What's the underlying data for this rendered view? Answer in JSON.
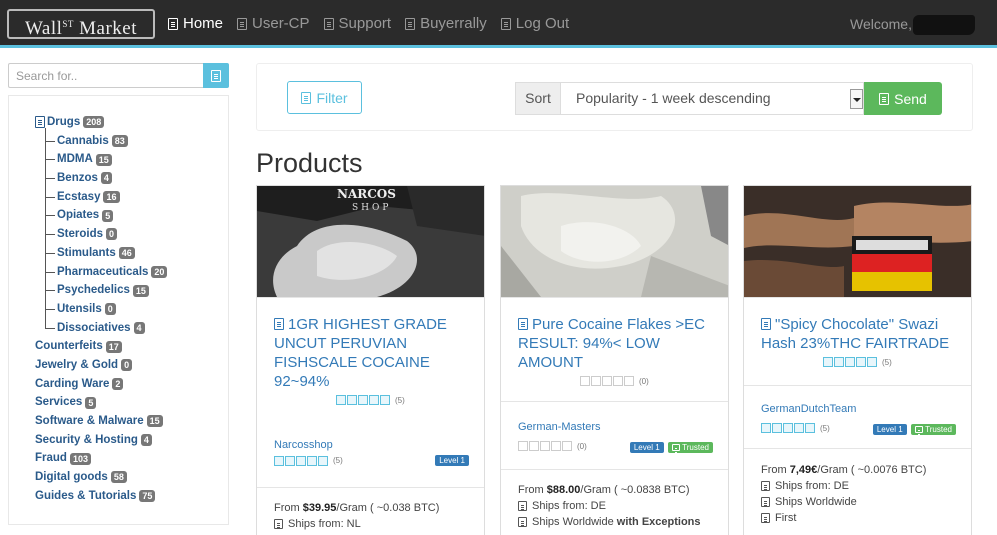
{
  "brand": {
    "name": "Wall",
    "sup": "ST",
    "name2": "Market"
  },
  "nav": [
    {
      "label": "Home",
      "active": true
    },
    {
      "label": "User-CP"
    },
    {
      "label": "Support"
    },
    {
      "label": "Buyerrally"
    },
    {
      "label": "Log Out"
    }
  ],
  "welcome": "Welcome,",
  "search": {
    "placeholder": "Search for.."
  },
  "categories": {
    "drugs": {
      "label": "Drugs",
      "count": "208"
    },
    "drug_subs": [
      {
        "label": "Cannabis",
        "count": "83"
      },
      {
        "label": "MDMA",
        "count": "15"
      },
      {
        "label": "Benzos",
        "count": "4"
      },
      {
        "label": "Ecstasy",
        "count": "16"
      },
      {
        "label": "Opiates",
        "count": "5"
      },
      {
        "label": "Steroids",
        "count": "0"
      },
      {
        "label": "Stimulants",
        "count": "46"
      },
      {
        "label": "Pharmaceuticals",
        "count": "20"
      },
      {
        "label": "Psychedelics",
        "count": "15"
      },
      {
        "label": "Utensils",
        "count": "0"
      },
      {
        "label": "Dissociatives",
        "count": "4"
      }
    ],
    "others": [
      {
        "label": "Counterfeits",
        "count": "17"
      },
      {
        "label": "Jewelry & Gold",
        "count": "0"
      },
      {
        "label": "Carding Ware",
        "count": "2"
      },
      {
        "label": "Services",
        "count": "5"
      },
      {
        "label": "Software & Malware",
        "count": "15"
      },
      {
        "label": "Security & Hosting",
        "count": "4"
      },
      {
        "label": "Fraud",
        "count": "103"
      },
      {
        "label": "Digital goods",
        "count": "58"
      },
      {
        "label": "Guides & Tutorials",
        "count": "75"
      }
    ]
  },
  "filter": {
    "filter_label": "Filter",
    "sort_label": "Sort",
    "sort_value": "Popularity - 1 week descending",
    "send_label": "Send"
  },
  "page_title": "Products",
  "products": [
    {
      "title": "1GR HIGHEST GRADE UNCUT PERUVIAN FISHSCALE COCAINE 92~94%",
      "rating_count": "(5)",
      "vendor": "Narcosshop",
      "vendor_rating_count": "(5)",
      "level": "Level 1",
      "price_prefix": "From ",
      "price": "$39.95",
      "price_suffix": "/Gram ( ~0.038 BTC)",
      "ships_from": "Ships from: NL",
      "image_text_1": "NARCOS",
      "image_text_2": "SHOP"
    },
    {
      "title": "Pure Cocaine Flakes >EC RESULT: 94%< LOW AMOUNT",
      "rating_count": "(0)",
      "vendor": "German-Masters",
      "vendor_rating_count": "(0)",
      "level": "Level 1",
      "trusted": "Trusted",
      "price_prefix": "From ",
      "price": "$88.00",
      "price_suffix": "/Gram ( ~0.0838 BTC)",
      "ships_from": "Ships from: DE",
      "ships_to_a": "Ships Worldwide ",
      "ships_to_b": "with Exceptions"
    },
    {
      "title": "\"Spicy Chocolate\" Swazi Hash 23%THC FAIRTRADE",
      "rating_count": "(5)",
      "vendor": "GermanDutchTeam",
      "vendor_rating_count": "(5)",
      "level": "Level 1",
      "trusted": "Trusted",
      "price_prefix": "From ",
      "price": "7,49€",
      "price_suffix": "/Gram ( ~0.0076 BTC)",
      "ships_from": "Ships from: DE",
      "ships_to": "Ships Worldwide",
      "shipping": "First"
    }
  ],
  "colors": {
    "accent": "#5bc0de",
    "link": "#337ab7",
    "success": "#5cb85c",
    "navbar": "#2b2b2b"
  }
}
